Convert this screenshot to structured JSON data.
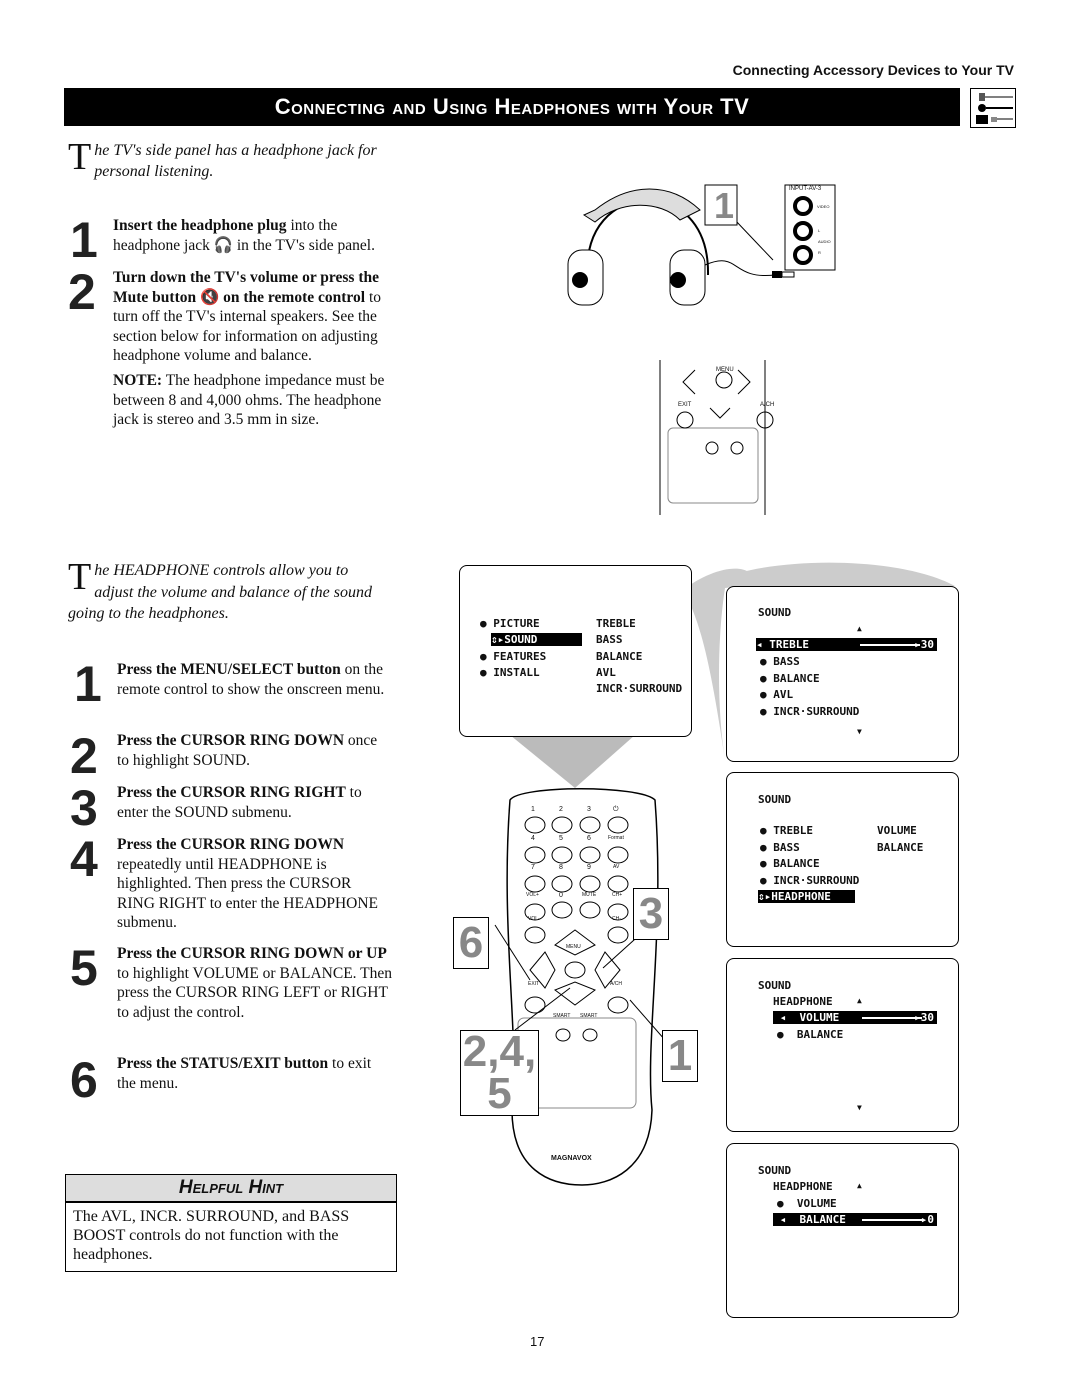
{
  "running_header": "Connecting Accessory Devices to Your TV",
  "banner_title": "Connecting and Using Headphones with Your TV",
  "banner_icon": "cable-connectors-icon",
  "intro1": {
    "dropcap": "T",
    "text": "he TV's side panel has a headphone jack for personal listening."
  },
  "part1_steps": [
    {
      "num": "1",
      "bold": "Insert the headphone plug",
      "text": " into the headphone jack 🎧 in the TV's side panel."
    },
    {
      "num": "2",
      "bold": "Turn down the TV's volume or press the Mute button 🔇 on the remote control",
      "text": " to turn off the TV's internal speakers. See the section below for information on adjusting headphone volume and balance."
    }
  ],
  "note": {
    "bold": "NOTE:",
    "text": " The headphone impedance must be between 8 and 4,000 ohms. The headphone jack is stereo and 3.5 mm in size."
  },
  "intro2": {
    "dropcap": "T",
    "text": "he HEADPHONE controls allow you to adjust the volume and balance of the sound going to the headphones."
  },
  "part2_steps": [
    {
      "num": "1",
      "bold": "Press the MENU/SELECT button",
      "text": " on the remote control to show the onscreen menu."
    },
    {
      "num": "2",
      "bold": "Press the CURSOR RING DOWN",
      "text": " once to highlight SOUND."
    },
    {
      "num": "3",
      "bold": "Press the CURSOR RING RIGHT",
      "text": " to enter the SOUND submenu."
    },
    {
      "num": "4",
      "bold": "Press the CURSOR RING DOWN",
      "text": " repeatedly until HEADPHONE is highlighted. Then press the CURSOR RING RIGHT to enter the HEADPHONE submenu."
    },
    {
      "num": "5",
      "bold": "Press the CURSOR RING DOWN or UP",
      "text": " to highlight VOLUME or BALANCE. Then press the CURSOR RING LEFT or RIGHT to adjust the control."
    },
    {
      "num": "6",
      "bold": "Press the STATUS/EXIT button",
      "text": " to exit the menu."
    }
  ],
  "hint": {
    "title": "Helpful Hint",
    "body": "The AVL, INCR. SURROUND, and BASS BOOST controls do not function with the headphones."
  },
  "jack_panel": {
    "title": "INPUT-AV-3",
    "video": "VIDEO",
    "l": "L",
    "audio": "AUDIO",
    "r": "R"
  },
  "top_callout": "1",
  "remote": {
    "brand": "MAGNAVOX",
    "keys": [
      "1",
      "2",
      "3",
      "⏻",
      "4",
      "5",
      "6",
      "Format",
      "7",
      "8",
      "9",
      "AV",
      "VOL+",
      "0",
      "MUTE",
      "CH+",
      "VOL-",
      "CH-",
      "MENU",
      "EXIT",
      "A/CH",
      "SMART",
      "SMART"
    ]
  },
  "callouts": {
    "c6": "6",
    "c3": "3",
    "c245": "2,4,\n5",
    "c1": "1"
  },
  "osd_main": {
    "left": [
      "PICTURE",
      "SOUND",
      "FEATURES",
      "INSTALL"
    ],
    "right": [
      "TREBLE",
      "BASS",
      "BALANCE",
      "AVL",
      "INCR·SURROUND"
    ],
    "selected": "SOUND"
  },
  "osd_treble": {
    "title": "SOUND",
    "selected": "TREBLE",
    "value": "30",
    "level": 0.3,
    "items": [
      "BASS",
      "BALANCE",
      "AVL",
      "INCR·SURROUND"
    ]
  },
  "osd_headphone": {
    "title": "SOUND",
    "items": [
      "TREBLE",
      "BASS",
      "BALANCE",
      "INCR·SURROUND"
    ],
    "selected": "HEADPHONE",
    "right": [
      "VOLUME",
      "BALANCE"
    ]
  },
  "osd_volume": {
    "title": "SOUND",
    "sub": "HEADPHONE",
    "selected": "VOLUME",
    "value": "30",
    "level": 0.3,
    "other": "BALANCE"
  },
  "osd_balance": {
    "title": "SOUND",
    "sub": "HEADPHONE",
    "other": "VOLUME",
    "selected": "BALANCE",
    "value": "0",
    "level": 0.5
  },
  "page_number": "17"
}
